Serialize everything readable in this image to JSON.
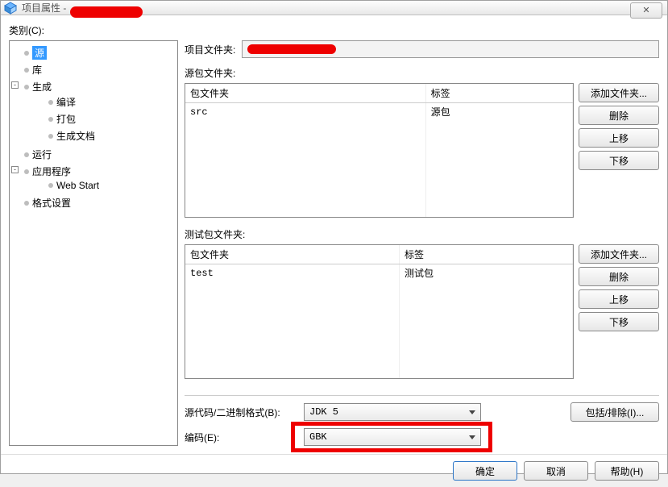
{
  "title_prefix": "项目属性 - ",
  "close_icon": "✕",
  "category_label": "类别(C):",
  "tree": {
    "n_source": "源",
    "n_lib": "库",
    "n_build": "生成",
    "n_compile": "编译",
    "n_pack": "打包",
    "n_builddoc": "生成文档",
    "n_run": "运行",
    "n_app": "应用程序",
    "n_webstart": "Web Start",
    "n_format": "格式设置"
  },
  "fields": {
    "project_folder": "项目文件夹:",
    "source_pkg": "源包文件夹:",
    "test_pkg": "测试包文件夹:",
    "src_bin_fmt": "源代码/二进制格式(B):",
    "encoding": "编码(E):"
  },
  "table": {
    "col_folder": "包文件夹",
    "col_label": "标签",
    "src_row": {
      "folder": "src",
      "label": "源包"
    },
    "test_row": {
      "folder": "test",
      "label": "测试包"
    }
  },
  "buttons": {
    "add_folder": "添加文件夹...",
    "remove": "删除",
    "move_up": "上移",
    "move_down": "下移",
    "include_exclude": "包括/排除(I)...",
    "ok": "确定",
    "cancel": "取消",
    "help": "帮助(H)"
  },
  "combo": {
    "jdk": "JDK 5",
    "enc": "GBK"
  }
}
